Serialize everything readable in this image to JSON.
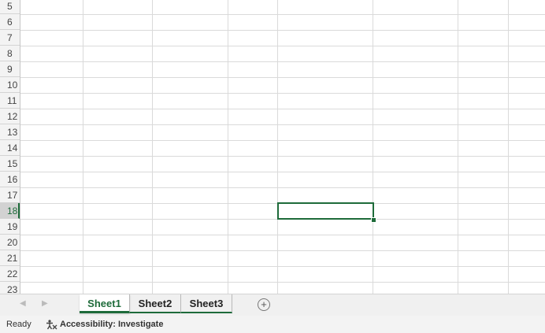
{
  "grid": {
    "rows": [
      {
        "label": "5"
      },
      {
        "label": "6"
      },
      {
        "label": "7"
      },
      {
        "label": "8"
      },
      {
        "label": "9"
      },
      {
        "label": "10"
      },
      {
        "label": "11"
      },
      {
        "label": "12"
      },
      {
        "label": "13"
      },
      {
        "label": "14"
      },
      {
        "label": "15"
      },
      {
        "label": "16"
      },
      {
        "label": "17"
      },
      {
        "label": "18",
        "selected": true
      },
      {
        "label": "19"
      },
      {
        "label": "20"
      },
      {
        "label": "21"
      },
      {
        "label": "22"
      },
      {
        "label": "23"
      }
    ]
  },
  "tabs": [
    {
      "label": "Sheet1",
      "active": true
    },
    {
      "label": "Sheet2",
      "active": false
    },
    {
      "label": "Sheet3",
      "active": false
    }
  ],
  "add_sheet_symbol": "+",
  "nav": {
    "prev_symbol": "◀",
    "next_symbol": "▶"
  },
  "status": {
    "ready": "Ready",
    "accessibility": "Accessibility: Investigate"
  },
  "colors": {
    "accent": "#1e6b3a"
  }
}
